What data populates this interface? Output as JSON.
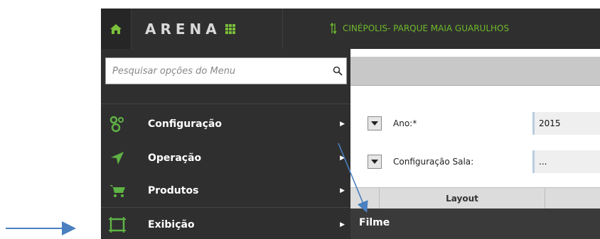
{
  "brand": {
    "logo_text": "ARENA"
  },
  "header": {
    "cinema": "CINÉPOLIS- PARQUE MAIA GUARULHOS"
  },
  "search": {
    "placeholder": "Pesquisar opções do Menu"
  },
  "menu": {
    "items": [
      {
        "label": "Configuração",
        "icon": "gears-icon"
      },
      {
        "label": "Operação",
        "icon": "location-arrow-icon"
      },
      {
        "label": "Produtos",
        "icon": "cart-icon"
      },
      {
        "label": "Exibição",
        "icon": "screen-frame-icon"
      }
    ]
  },
  "form": {
    "ano_label": "Ano:*",
    "ano_value": "2015",
    "config_label": "Configuração Sala:",
    "config_value": "..."
  },
  "table": {
    "layout_header": "Layout"
  },
  "submenu": {
    "filme_label": "Filme"
  },
  "colors": {
    "accent": "#6fba2c",
    "sidebar": "#2f2f2f",
    "annotation": "#4a7fc0"
  }
}
